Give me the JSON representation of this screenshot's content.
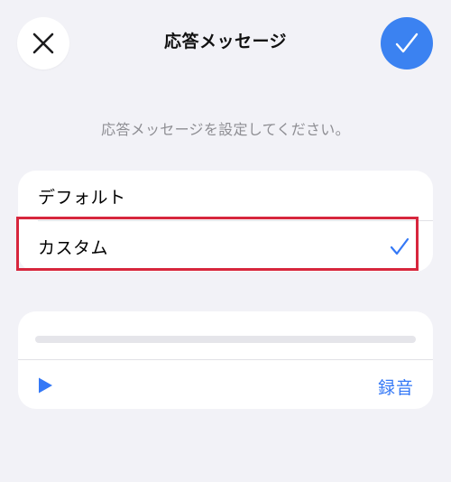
{
  "header": {
    "title": "応答メッセージ",
    "close_icon": "close-icon",
    "done_icon": "checkmark-icon"
  },
  "subtitle": "応答メッセージを設定してください。",
  "options": [
    {
      "label": "デフォルト",
      "selected": false
    },
    {
      "label": "カスタム",
      "selected": true
    }
  ],
  "recorder": {
    "progress": 0,
    "play_icon": "play-icon",
    "record_label": "録音"
  },
  "colors": {
    "accent": "#3478f6",
    "done_button": "#3b82f1",
    "background": "#f2f2f7",
    "highlight": "#d7263d"
  }
}
